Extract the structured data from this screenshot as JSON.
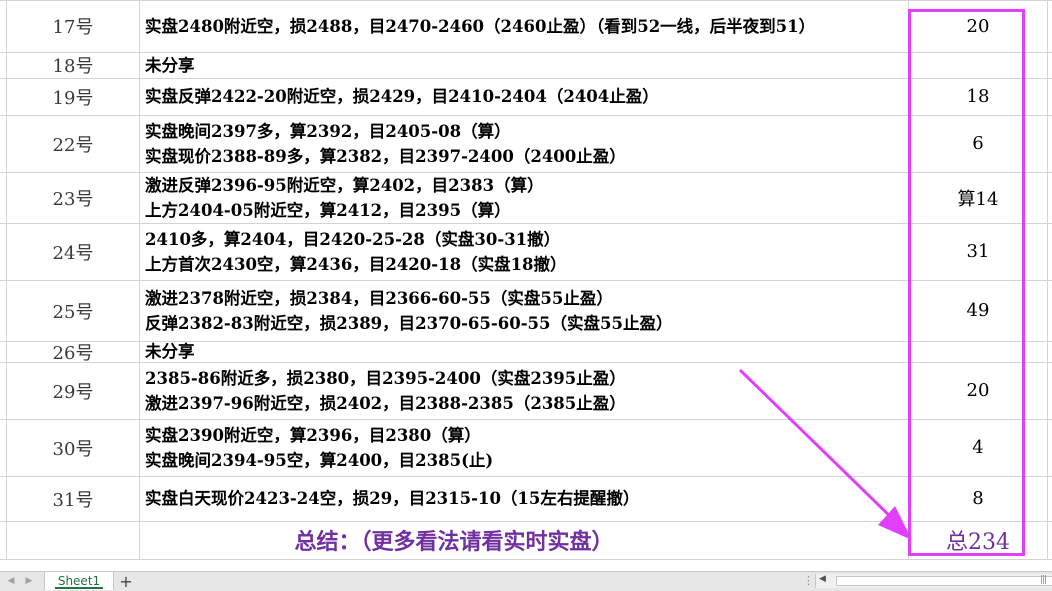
{
  "table": {
    "rows": [
      {
        "day": "17号",
        "lines": [
          "实盘2480附近空，损2488，目2470-2460（2460止盈）（看到52一线，后半夜到51）"
        ],
        "points": "20"
      },
      {
        "day": "18号",
        "lines": [
          "未分享"
        ],
        "points": ""
      },
      {
        "day": "19号",
        "lines": [
          "实盘反弹2422-20附近空，损2429，目2410-2404（2404止盈）"
        ],
        "points": "18"
      },
      {
        "day": "22号",
        "lines": [
          "实盘晚间2397多，算2392，目2405-08（算）",
          "实盘现价2388-89多，算2382，目2397-2400（2400止盈）"
        ],
        "points": "6"
      },
      {
        "day": "23号",
        "lines": [
          "激进反弹2396-95附近空，算2402，目2383（算）",
          "上方2404-05附近空，算2412，目2395（算）"
        ],
        "points": "算14"
      },
      {
        "day": "24号",
        "lines": [
          "2410多，算2404，目2420-25-28（实盘30-31撤）",
          "上方首次2430空，算2436，目2420-18（实盘18撤）"
        ],
        "points": "31"
      },
      {
        "day": "25号",
        "lines": [
          "激进2378附近空，损2384，目2366-60-55（实盘55止盈）",
          "反弹2382-83附近空，损2389，目2370-65-60-55（实盘55止盈）"
        ],
        "points": "49"
      },
      {
        "day": "26号",
        "lines": [
          "未分享"
        ],
        "points": ""
      },
      {
        "day": "29号",
        "lines": [
          "2385-86附近多，损2380，目2395-2400（实盘2395止盈）",
          "激进2397-96附近空，损2402，目2388-2385（2385止盈）"
        ],
        "points": "20"
      },
      {
        "day": "30号",
        "lines": [
          "实盘2390附近空，算2396，目2380（算）",
          "实盘晚间2394-95空，算2400，目2385(止)"
        ],
        "points": "4"
      },
      {
        "day": "31号",
        "lines": [
          "实盘白天现价2423-24空，损29，目2315-10（15左右提醒撤）"
        ],
        "points": "8"
      }
    ],
    "summary_label": "总结：（更多看法请看实时实盘）",
    "summary_total": "总234"
  },
  "colors": {
    "highlight": "#e040fb",
    "summary_text": "#7030a0",
    "sheet_tab": "#217346",
    "gridline": "#d4d4d4"
  },
  "tabbar": {
    "sheet_name": "Sheet1",
    "add_symbol": "+",
    "nav_first": "◀",
    "nav_prev": "▶",
    "scroll_left": "◀",
    "scroll_grip": "|||",
    "split_dots": "⋮"
  }
}
